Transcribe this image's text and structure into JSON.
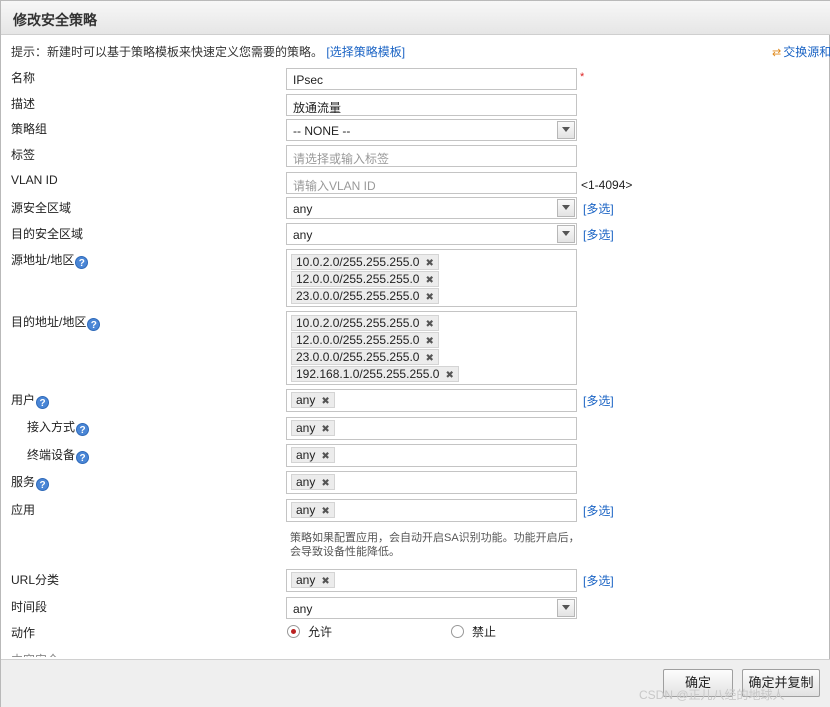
{
  "dialog": {
    "title": "修改安全策略"
  },
  "hint": {
    "text": "提示：新建时可以基于策略模板来快速定义您需要的策略。",
    "link": "[选择策略模板]"
  },
  "switch_link": "交换源和",
  "form": {
    "name": {
      "label": "名称",
      "value": "IPsec",
      "required_mark": "*"
    },
    "description": {
      "label": "描述",
      "value": "放通流量"
    },
    "policy_group": {
      "label": "策略组",
      "value": "-- NONE --"
    },
    "tag": {
      "label": "标签",
      "placeholder": "请选择或输入标签"
    },
    "vlan_id": {
      "label": "VLAN ID",
      "placeholder": "请输入VLAN ID",
      "range": "<1-4094>"
    },
    "src_zone": {
      "label": "源安全区域",
      "value": "any",
      "multi": "[多选]"
    },
    "dst_zone": {
      "label": "目的安全区域",
      "value": "any",
      "multi": "[多选]"
    },
    "src_addr": {
      "label": "源地址/地区",
      "tags": [
        "10.0.2.0/255.255.255.0",
        "12.0.0.0/255.255.255.0",
        "23.0.0.0/255.255.255.0"
      ]
    },
    "dst_addr": {
      "label": "目的地址/地区",
      "tags": [
        "10.0.2.0/255.255.255.0",
        "12.0.0.0/255.255.255.0",
        "23.0.0.0/255.255.255.0",
        "192.168.1.0/255.255.255.0"
      ]
    },
    "user": {
      "label": "用户",
      "tag": "any",
      "multi": "[多选]"
    },
    "access_mode": {
      "label": "接入方式",
      "tag": "any"
    },
    "terminal": {
      "label": "终端设备",
      "tag": "any"
    },
    "service": {
      "label": "服务",
      "tag": "any"
    },
    "application": {
      "label": "应用",
      "tag": "any",
      "multi": "[多选]",
      "note": "策略如果配置应用，会自动开启SA识别功能。功能开启后，会导致设备性能降低。"
    },
    "url_category": {
      "label": "URL分类",
      "tag": "any",
      "multi": "[多选]"
    },
    "time_range": {
      "label": "时间段",
      "value": "any"
    },
    "action": {
      "label": "动作",
      "allow": "允许",
      "deny": "禁止",
      "selected": "允许"
    },
    "cut_label": "内容安全"
  },
  "footer": {
    "ok": "确定",
    "ok_copy": "确定并复制"
  },
  "watermark": "CSDN @正儿八经的地球人"
}
